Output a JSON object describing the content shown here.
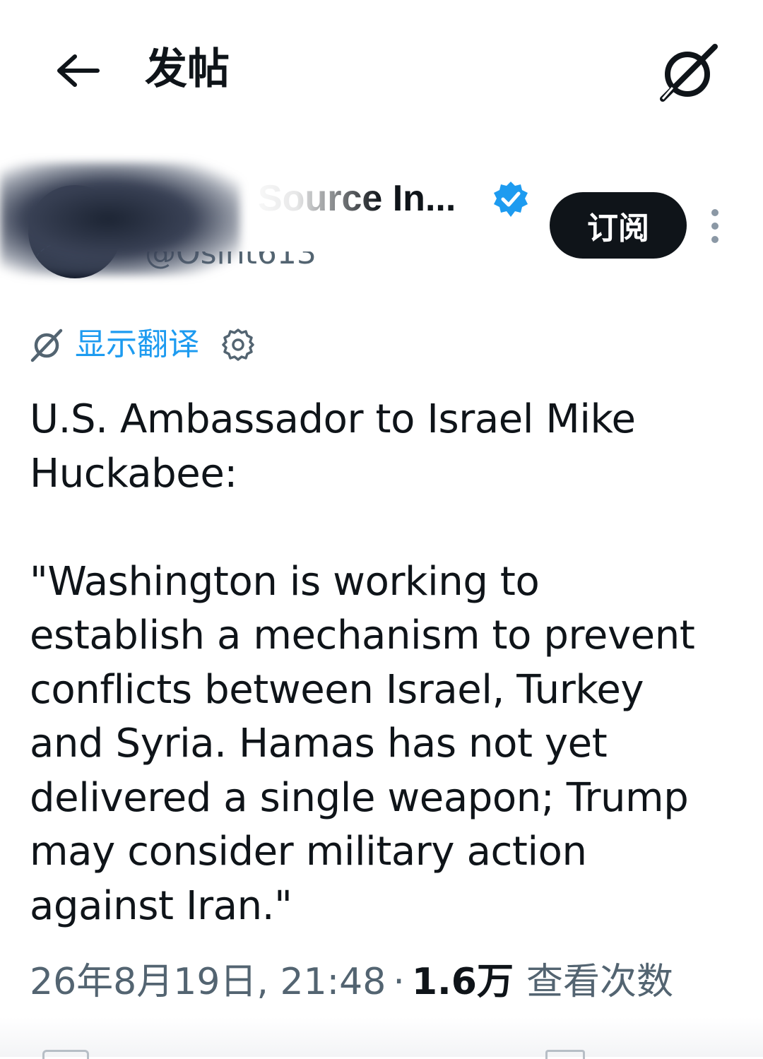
{
  "header": {
    "back_icon": "arrow-left-icon",
    "title": "发帖",
    "grok_icon": "grok-icon"
  },
  "author": {
    "display_name": "Source In...",
    "handle": "@Osint613",
    "verified_icon": "verified-badge-icon",
    "subscribe_label": "订阅",
    "more_icon": "more-vertical-icon"
  },
  "translate": {
    "icon": "grok-icon",
    "label": "显示翻译",
    "settings_icon": "gear-icon"
  },
  "tweet": {
    "text": "U.S. Ambassador to Israel Mike\nHuckabee:\n\n\"Washington is working to\nestablish a mechanism to prevent\nconflicts between Israel, Turkey\nand Syria. Hamas has not yet\ndelivered a single weapon; Trump\nmay consider military action\nagainst Iran.\""
  },
  "meta": {
    "date": "26年8月19日, 21:48",
    "separator": "·",
    "views_count": "1.6万",
    "views_label": "查看次数"
  },
  "colors": {
    "text": "#0f1419",
    "secondary": "#536471",
    "link": "#1d9bf0",
    "button_bg": "#0f1419"
  }
}
